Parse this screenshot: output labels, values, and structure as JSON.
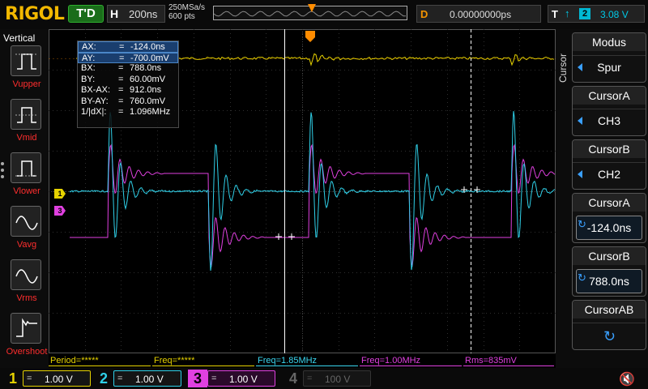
{
  "brand": "RIGOL",
  "top": {
    "trigger_status": "T'D",
    "timebase_key": "H",
    "timebase_value": "200ns",
    "sample_rate": "250MSa/s",
    "memory_depth": "600 pts",
    "delay_key": "D",
    "delay_value": "0.00000000ps",
    "trigger_key": "T",
    "trigger_edge": "↑",
    "trigger_source": "2",
    "trigger_level": "3.08 V"
  },
  "left_panel": {
    "title": "Vertical",
    "items": [
      {
        "label": "Vupper",
        "icon": "vupper-icon"
      },
      {
        "label": "Vmid",
        "icon": "vmid-icon"
      },
      {
        "label": "Vlower",
        "icon": "vlower-icon"
      },
      {
        "label": "Vavg",
        "icon": "vavg-icon"
      },
      {
        "label": "Vrms",
        "icon": "vrms-icon"
      },
      {
        "label": "Overshoot",
        "icon": "overshoot-icon"
      }
    ]
  },
  "readout": {
    "rows": [
      {
        "k": "AX:",
        "v": "-124.0ns",
        "hl": true
      },
      {
        "k": "AY:",
        "v": "-700.0mV",
        "hl": true
      },
      {
        "k": "BX:",
        "v": "788.0ns",
        "hl": false
      },
      {
        "k": "BY:",
        "v": "60.00mV",
        "hl": false
      },
      {
        "k": "BX-AX:",
        "v": "912.0ns",
        "hl": false
      },
      {
        "k": "BY-AY:",
        "v": "760.0mV",
        "hl": false
      },
      {
        "k": "1/|dX|:",
        "v": "1.096MHz",
        "hl": false
      }
    ],
    "eq": "="
  },
  "right_panel": {
    "vertical_label": "Cursor",
    "buttons": [
      {
        "title": "Modus",
        "value": "Spur",
        "style": "arrow"
      },
      {
        "title": "CursorA",
        "value": "CH3",
        "style": "arrow"
      },
      {
        "title": "CursorB",
        "value": "CH2",
        "style": "arrow"
      },
      {
        "title": "CursorA",
        "value": "-124.0ns",
        "style": "knob"
      },
      {
        "title": "CursorB",
        "value": "788.0ns",
        "style": "knob"
      },
      {
        "title": "CursorAB",
        "value": "",
        "style": "knob"
      }
    ]
  },
  "measurements": [
    {
      "text": "Period=*****",
      "color": "#e6d200"
    },
    {
      "text": "Freq=*****",
      "color": "#e6d200"
    },
    {
      "text": "Freq=1.85MHz",
      "color": "#3ad6f0"
    },
    {
      "text": "Freq=1.00MHz",
      "color": "#e040e0"
    },
    {
      "text": "Rms=835mV",
      "color": "#e040e0"
    }
  ],
  "channels": [
    {
      "num": "1",
      "coupling": "=",
      "scale": "1.00 V",
      "color": "#e6d200",
      "active": true
    },
    {
      "num": "2",
      "coupling": "=",
      "scale": "1.00 V",
      "color": "#2fd0e8",
      "active": true
    },
    {
      "num": "3",
      "coupling": "=",
      "scale": "1.00 V",
      "color": "#e040e0",
      "active": true
    },
    {
      "num": "4",
      "coupling": "=",
      "scale": "100 V",
      "color": "#3a3aa0",
      "active": false
    }
  ],
  "colors": {
    "ch1": "#e6d200",
    "ch2": "#2fd0e8",
    "ch3": "#e040e0",
    "trigger": "#ff8c00",
    "grid": "#3a3a3a"
  }
}
